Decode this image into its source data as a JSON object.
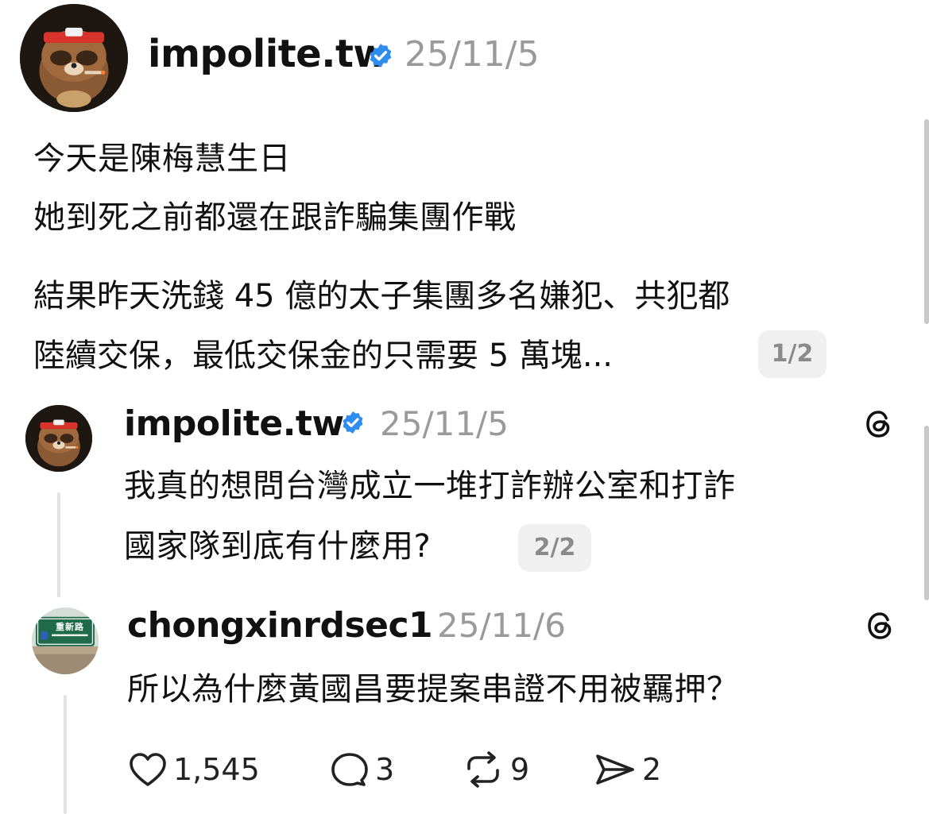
{
  "main_post": {
    "username": "impolite.tw",
    "date": "25/11/5",
    "lines": [
      "今天是陳梅慧生日",
      "她到死之前都還在跟詐騙集團作戰",
      "結果昨天洗錢 45 億的太子集團多名嫌犯、共犯都",
      "陸續交保，最低交保金的只需要 5 萬塊..."
    ],
    "page_indicator": "1/2"
  },
  "reply_1": {
    "username": "impolite.tw",
    "date": "25/11/5",
    "lines": [
      "我真的想問台灣成立一堆打詐辦公室和打詐",
      "國家隊到底有什麼用?"
    ],
    "page_indicator": "2/2"
  },
  "reply_2": {
    "username": "chongxinrdsec1",
    "date": "25/11/6",
    "lines": [
      "所以為什麼黃國昌要提案串證不用被羈押？"
    ],
    "avatar_sign_text": "重新路"
  },
  "actions": {
    "likes": "1,545",
    "comments": "3",
    "reposts": "9",
    "shares": "2"
  },
  "colors": {
    "verified": "#2f8cf1",
    "secondary_text": "#9a9a9a",
    "thread_line": "#e2e2e2"
  },
  "icons": [
    "verified-badge-icon",
    "threads-logo-icon",
    "heart-icon",
    "comment-icon",
    "repost-icon",
    "share-icon"
  ]
}
